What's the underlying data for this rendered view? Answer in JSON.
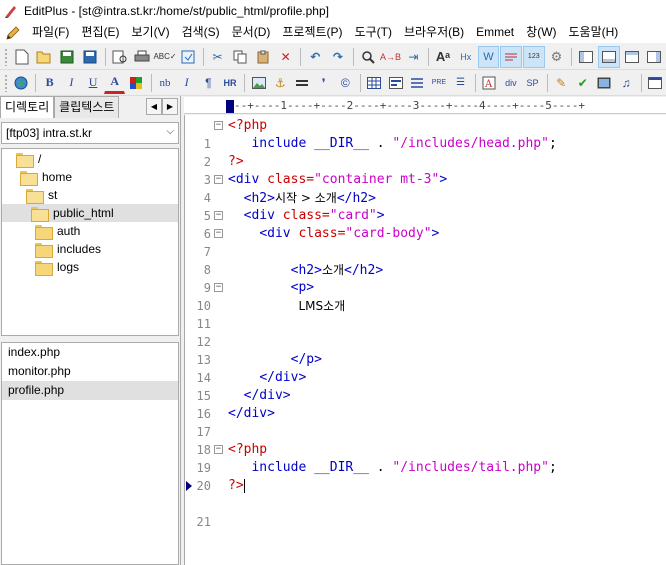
{
  "window": {
    "title": "EditPlus - [st@intra.st.kr:/home/st/public_html/profile.php]"
  },
  "menu": {
    "items": [
      "파일(F)",
      "편집(E)",
      "보기(V)",
      "검색(S)",
      "문서(D)",
      "프로젝트(P)",
      "도구(T)",
      "브라우저(B)",
      "Emmet",
      "창(W)",
      "도움말(H)"
    ]
  },
  "toolbar1": {
    "icons": [
      "new-file-icon",
      "open-folder-icon",
      "save-icon",
      "save-all-icon",
      "print-preview-icon",
      "print-icon",
      "spell-check-icon",
      "web-preview-icon",
      "cut-icon",
      "copy-icon",
      "paste-icon",
      "delete-icon",
      "undo-icon",
      "redo-icon",
      "find-icon",
      "replace-icon",
      "goto-icon",
      "font-size-icon",
      "hex-icon",
      "word-wrap-icon",
      "ruler-icon",
      "line-number-icon",
      "settings-icon",
      "panel-1-icon",
      "panel-2-icon",
      "panel-3-icon",
      "panel-4-icon"
    ]
  },
  "toolbar2": {
    "bold": "B",
    "italic": "I",
    "underline": "U",
    "font_color": "A",
    "nbsp": "nb",
    "italic_tag": "I",
    "para": "¶",
    "hr": "HR",
    "pre": "PRE",
    "div": "div",
    "span": "SP"
  },
  "panel": {
    "tabs": [
      "디렉토리",
      "클립텍스트"
    ],
    "ftp_account": "[ftp03] intra.st.kr",
    "tree": [
      {
        "label": "/",
        "indent": 0,
        "selected": false,
        "open": true
      },
      {
        "label": "home",
        "indent": 1,
        "selected": false,
        "open": true
      },
      {
        "label": "st",
        "indent": 2,
        "selected": false,
        "open": true
      },
      {
        "label": "public_html",
        "indent": 3,
        "selected": true,
        "open": true
      },
      {
        "label": "auth",
        "indent": 4,
        "selected": false,
        "open": false
      },
      {
        "label": "includes",
        "indent": 4,
        "selected": false,
        "open": false
      },
      {
        "label": "logs",
        "indent": 4,
        "selected": false,
        "open": false
      }
    ],
    "files": [
      {
        "label": "index.php",
        "selected": false
      },
      {
        "label": "monitor.php",
        "selected": false
      },
      {
        "label": "profile.php",
        "selected": true
      }
    ]
  },
  "ruler": {
    "text": "--+----1----+----2----+----3----+----4----+----5----+"
  },
  "editor": {
    "current_line": 21,
    "lines": [
      {
        "n": "1",
        "fold": "−"
      },
      {
        "n": "2",
        "fold": ""
      },
      {
        "n": "3",
        "fold": ""
      },
      {
        "n": "4",
        "fold": "−"
      },
      {
        "n": "5",
        "fold": ""
      },
      {
        "n": "6",
        "fold": "−"
      },
      {
        "n": "7",
        "fold": "−"
      },
      {
        "n": "8",
        "fold": ""
      },
      {
        "n": "9",
        "fold": ""
      },
      {
        "n": "10",
        "fold": "−"
      },
      {
        "n": "11",
        "fold": ""
      },
      {
        "n": "12",
        "fold": ""
      },
      {
        "n": "13",
        "fold": ""
      },
      {
        "n": "14",
        "fold": ""
      },
      {
        "n": "15",
        "fold": ""
      },
      {
        "n": "16",
        "fold": ""
      },
      {
        "n": "17",
        "fold": ""
      },
      {
        "n": "18",
        "fold": ""
      },
      {
        "n": "19",
        "fold": "−"
      },
      {
        "n": "20",
        "fold": ""
      },
      {
        "n": "21",
        "fold": ""
      }
    ],
    "code": {
      "l1_open": "<?php",
      "l2_kw": "include",
      "l2_dir": "__DIR__",
      "l2_dot": " . ",
      "l2_str": "\"/includes/head.php\"",
      "l2_semi": ";",
      "l3_close": "?>",
      "l4_tag_open": "<div",
      "l4_attr": "class=",
      "l4_val": "\"container mt-3\"",
      "l4_end": ">",
      "l5_open": "<h2>",
      "l5_text": "시작 > 소개",
      "l5_close": "</h2>",
      "l6_tag_open": "<div",
      "l6_attr": "class=",
      "l6_val": "\"card\"",
      "l6_end": ">",
      "l7_tag_open": "<div",
      "l7_attr": "class=",
      "l7_val": "\"card-body\"",
      "l7_end": ">",
      "l9_open": "<h2>",
      "l9_text": "소개",
      "l9_close": "</h2>",
      "l10_open": "<p>",
      "l11_text": "LMS소개",
      "l14_close": "</p>",
      "l15_close": "</div>",
      "l16_close": "</div>",
      "l17_close": "</div>",
      "l19_open": "<?php",
      "l20_kw": "include",
      "l20_dir": "__DIR__",
      "l20_dot": " . ",
      "l20_str": "\"/includes/tail.php\"",
      "l20_semi": ";",
      "l21_close": "?>"
    }
  }
}
